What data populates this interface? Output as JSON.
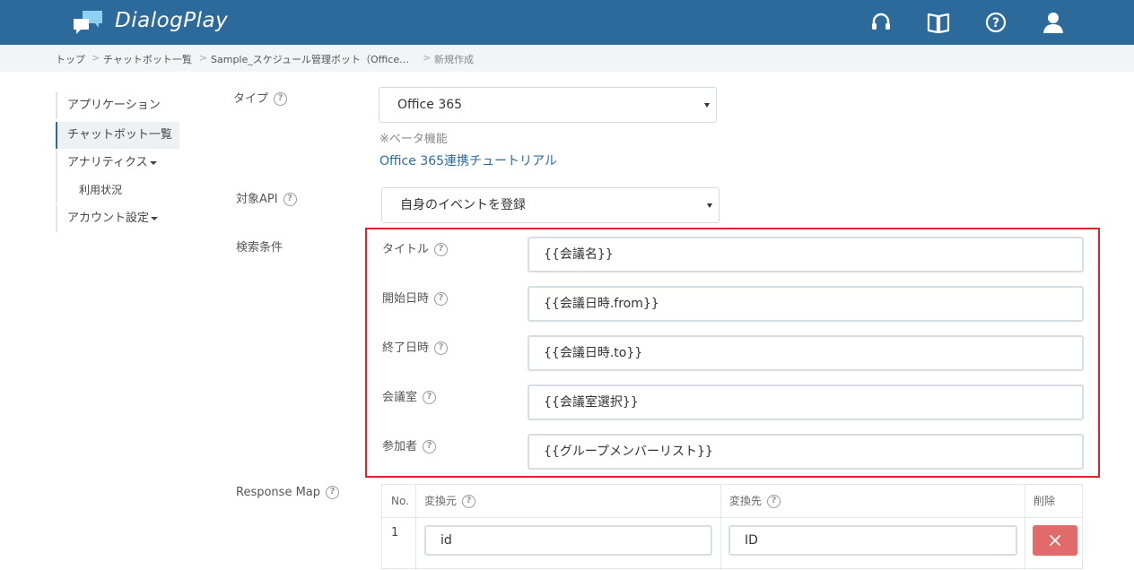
{
  "header": {
    "brand": "DialogPlay",
    "icons": [
      "support-headset-icon",
      "manual-book-icon",
      "help-icon",
      "user-icon"
    ]
  },
  "breadcrumb": {
    "items": [
      "トップ",
      "チャットボット一覧",
      "Sample_スケジュール管理ボット（Office…",
      "新規作成"
    ],
    "separator": ">"
  },
  "sidebar": {
    "items": [
      {
        "label": "アプリケーション"
      },
      {
        "label": "チャットボット一覧"
      },
      {
        "label": "アナリティクス"
      },
      {
        "label": "利用状況"
      },
      {
        "label": "アカウント設定"
      }
    ]
  },
  "form": {
    "type": {
      "label": "タイプ",
      "value": "Office 365",
      "note": "※ベータ機能",
      "link": "Office 365連携チュートリアル"
    },
    "api": {
      "label": "対象API",
      "value": "自身のイベントを登録"
    },
    "search": {
      "label": "検索条件",
      "fields": [
        {
          "label": "タイトル",
          "value": "{{会議名}}"
        },
        {
          "label": "開始日時",
          "value": "{{会議日時.from}}"
        },
        {
          "label": "終了日時",
          "value": "{{会議日時.to}}"
        },
        {
          "label": "会議室",
          "value": "{{会議室選択}}"
        },
        {
          "label": "参加者",
          "value": "{{グループメンバーリスト}}"
        }
      ]
    },
    "response_map": {
      "label": "Response Map",
      "headers": {
        "no": "No.",
        "source": "変換元",
        "target": "変換先",
        "delete": "削除"
      },
      "rows": [
        {
          "no": "1",
          "source": "id",
          "target": "ID"
        }
      ]
    }
  },
  "colors": {
    "header": "#2c6a9c",
    "highlight_border": "#d9262c",
    "delete_button": "#e16a6a",
    "link": "#2c6a9c"
  },
  "help_mark": "?"
}
